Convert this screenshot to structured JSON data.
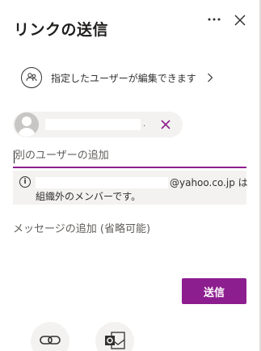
{
  "header": {
    "title": "リンクの送信",
    "more_icon": "more-horizontal-icon",
    "close_icon": "close-icon"
  },
  "permission": {
    "label": "指定したユーザーが編集できます",
    "icon": "people-icon",
    "chevron_icon": "chevron-right-icon"
  },
  "recipient": {
    "name": "",
    "trailing": ".",
    "remove_icon": "close-icon",
    "avatar_icon": "person-avatar"
  },
  "add_field": {
    "placeholder": "別のユーザーの追加",
    "value": ""
  },
  "warning": {
    "icon": "info-icon",
    "icon_glyph": "i",
    "redacted_text": "",
    "domain_text": "@yahoo.co.jp は",
    "line2": "組織外のメンバーです。"
  },
  "message": {
    "placeholder": "メッセージの追加 (省略可能)",
    "value": ""
  },
  "send_button": {
    "label": "送信"
  },
  "share_options": [
    {
      "icon": "copy-link-icon"
    },
    {
      "icon": "outlook-icon"
    }
  ],
  "colors": {
    "accent": "#8d1e8f",
    "surface": "#f3f2f1",
    "text": "#323130"
  }
}
